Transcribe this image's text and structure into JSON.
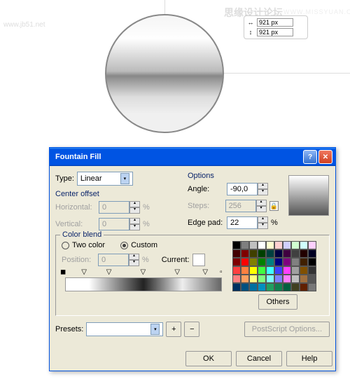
{
  "watermarks": {
    "left": "www.jb51.net",
    "center": "思缘设计论坛",
    "right": "WWW.MISSYUAN.COM"
  },
  "size": {
    "width": "921 px",
    "height": "921 px"
  },
  "dialog": {
    "title": "Fountain Fill",
    "type_label": "Type:",
    "type_value": "Linear",
    "center_offset": "Center offset",
    "horizontal": "Horizontal:",
    "horizontal_val": "0",
    "vertical": "Vertical:",
    "vertical_val": "0",
    "options": "Options",
    "angle": "Angle:",
    "angle_val": "-90,0",
    "steps": "Steps:",
    "steps_val": "256",
    "edgepad": "Edge pad:",
    "edgepad_val": "22",
    "pct": "%",
    "color_blend": "Color blend",
    "two_color": "Two color",
    "custom": "Custom",
    "position": "Position:",
    "position_val": "0",
    "current": "Current:",
    "others": "Others",
    "presets": "Presets:",
    "postscript": "PostScript Options...",
    "ok": "OK",
    "cancel": "Cancel",
    "help": "Help"
  },
  "palette": [
    [
      "#000",
      "#7f7f7f",
      "#c0c0c0",
      "#fff",
      "#ffffd0",
      "#ffd0d0",
      "#d0d0ff",
      "#d0ffd0",
      "#d0ffff",
      "#ffd0ff"
    ],
    [
      "#400",
      "#7f0000",
      "#404000",
      "#004000",
      "#004040",
      "#000040",
      "#400040",
      "#404040",
      "#200",
      "#002"
    ],
    [
      "#800000",
      "#ff0000",
      "#808000",
      "#008000",
      "#008080",
      "#000080",
      "#800080",
      "#808080",
      "#402000",
      "#000"
    ],
    [
      "#ff4040",
      "#ff8040",
      "#ffff00",
      "#40ff40",
      "#40ffff",
      "#4040ff",
      "#ff40ff",
      "#a0a0a0",
      "#805000",
      "#333"
    ],
    [
      "#ff8080",
      "#ffa060",
      "#ffff80",
      "#80ff80",
      "#80ffff",
      "#8080ff",
      "#ff80ff",
      "#c0c0c0",
      "#a07040",
      "#555"
    ],
    [
      "#003060",
      "#005080",
      "#0070a0",
      "#0090c0",
      "#20a060",
      "#108050",
      "#006040",
      "#404020",
      "#602000",
      "#777"
    ]
  ]
}
